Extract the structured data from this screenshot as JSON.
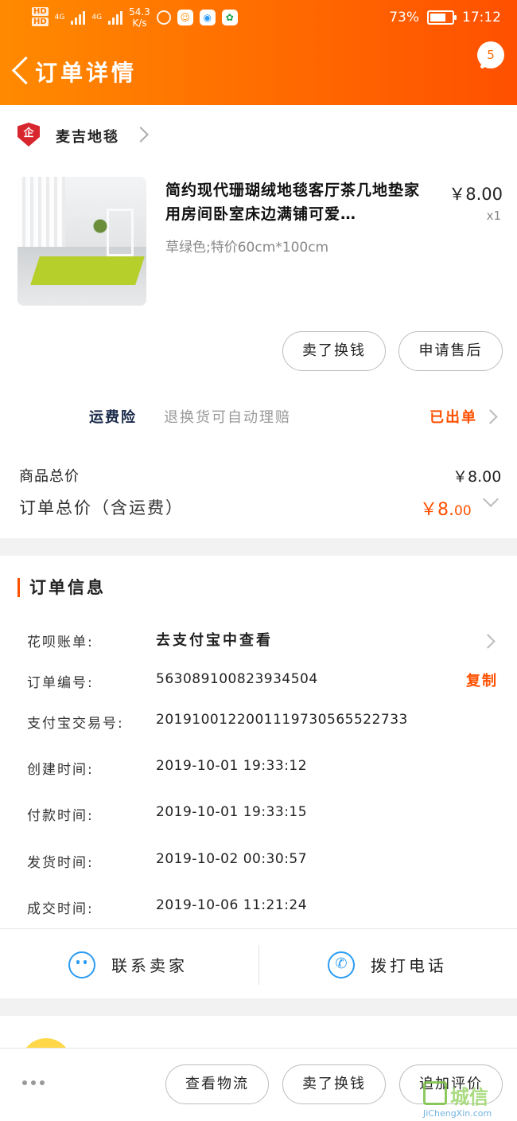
{
  "status_bar": {
    "hd1": "HD",
    "hd2": "HD",
    "net1": "4G",
    "net2": "4G",
    "speed_value": "54.3",
    "speed_unit": "K/s",
    "battery": "73%",
    "battery_level": 0.73,
    "time": "17:12"
  },
  "nav": {
    "title": "订单详情",
    "badge": "5"
  },
  "shop": {
    "logo_text": "企",
    "name": "麦吉地毯"
  },
  "product": {
    "title": "简约现代珊瑚绒地毯客厅茶几地垫家用房间卧室床边满铺可爱…",
    "sku": "草绿色;特价60cm*100cm",
    "price": "￥8.00",
    "qty": "x1"
  },
  "product_actions": {
    "sell": "卖了换钱",
    "after_sale": "申请售后"
  },
  "insurance": {
    "label": "运费险",
    "desc": "退换货可自动理赔",
    "status": "已出单"
  },
  "summary": {
    "goods_total_label": "商品总价",
    "goods_total_value": "￥8.00",
    "order_total_label": "订单总价（含运费）",
    "order_total_main": "￥8.",
    "order_total_cents": "00"
  },
  "order_info": {
    "heading": "订单信息",
    "huabei_label": "花呗账单:",
    "huabei_link": "去支付宝中查看",
    "order_no_label": "订单编号:",
    "order_no": "563089100823934504",
    "copy": "复制",
    "alipay_no_label": "支付宝交易号:",
    "alipay_no": "2019100122001119730565522733",
    "created_label": "创建时间:",
    "created": "2019-10-01 19:33:12",
    "paid_label": "付款时间:",
    "paid": "2019-10-01 19:33:15",
    "shipped_label": "发货时间:",
    "shipped": "2019-10-02 00:30:57",
    "completed_label": "成交时间:",
    "completed": "2019-10-06 11:21:24"
  },
  "contact": {
    "seller": "联系卖家",
    "call": "拨打电话"
  },
  "bottom_actions": {
    "logistics": "查看物流",
    "sell": "卖了换钱",
    "review": "追加评价"
  },
  "watermark": {
    "text": "城信",
    "url": "JiChengXin.com"
  },
  "colors": {
    "accent": "#ff5000",
    "header_start": "#ff8a00",
    "header_end": "#ff5000",
    "icon_blue": "#2b9cf2"
  }
}
